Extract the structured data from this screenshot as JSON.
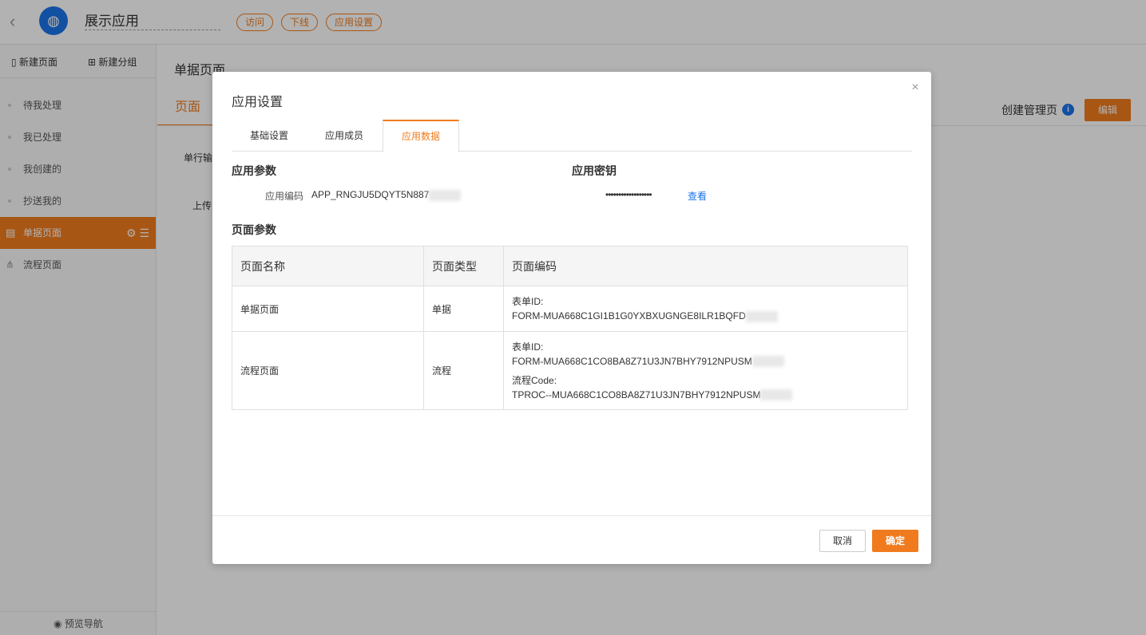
{
  "topbar": {
    "app_name": "展示应用",
    "pills": [
      "访问",
      "下线",
      "应用设置"
    ]
  },
  "sidebar": {
    "new_page": "新建页面",
    "new_group": "新建分组",
    "items": [
      {
        "label": "待我处理"
      },
      {
        "label": "我已处理"
      },
      {
        "label": "我创建的"
      },
      {
        "label": "抄送我的"
      },
      {
        "label": "单据页面"
      },
      {
        "label": "流程页面"
      }
    ],
    "preview_nav": "预览导航"
  },
  "main": {
    "title": "单据页面",
    "tab": "页面",
    "right_label": "创建管理页",
    "edit_button": "编辑",
    "field_labels": [
      "单行输",
      "上传"
    ]
  },
  "modal": {
    "title": "应用设置",
    "close": "×",
    "tabs": [
      {
        "label": "基础设置"
      },
      {
        "label": "应用成员"
      },
      {
        "label": "应用数据"
      }
    ],
    "app_params": {
      "title": "应用参数",
      "code_label": "应用编码",
      "code_value": "APP_RNGJU5DQYT5N887"
    },
    "app_secret": {
      "title": "应用密钥",
      "masked": "••••••••••••••••••",
      "view_link": "查看"
    },
    "page_params": {
      "title": "页面参数",
      "headers": [
        "页面名称",
        "页面类型",
        "页面编码"
      ],
      "rows": [
        {
          "name": "单据页面",
          "type": "单据",
          "form_id_label": "表单ID:",
          "form_id": "FORM-MUA668C1GI1B1G0YXBXUGNGE8ILR1BQFD"
        },
        {
          "name": "流程页面",
          "type": "流程",
          "form_id_label": "表单ID:",
          "form_id": "FORM-MUA668C1CO8BA8Z71U3JN7BHY7912NPUSM",
          "proc_label": "流程Code:",
          "proc_code": "TPROC--MUA668C1CO8BA8Z71U3JN7BHY7912NPUSM"
        }
      ]
    },
    "footer": {
      "cancel": "取消",
      "ok": "确定"
    }
  },
  "colors": {
    "accent": "#f07b1e",
    "link": "#1a73e8"
  }
}
